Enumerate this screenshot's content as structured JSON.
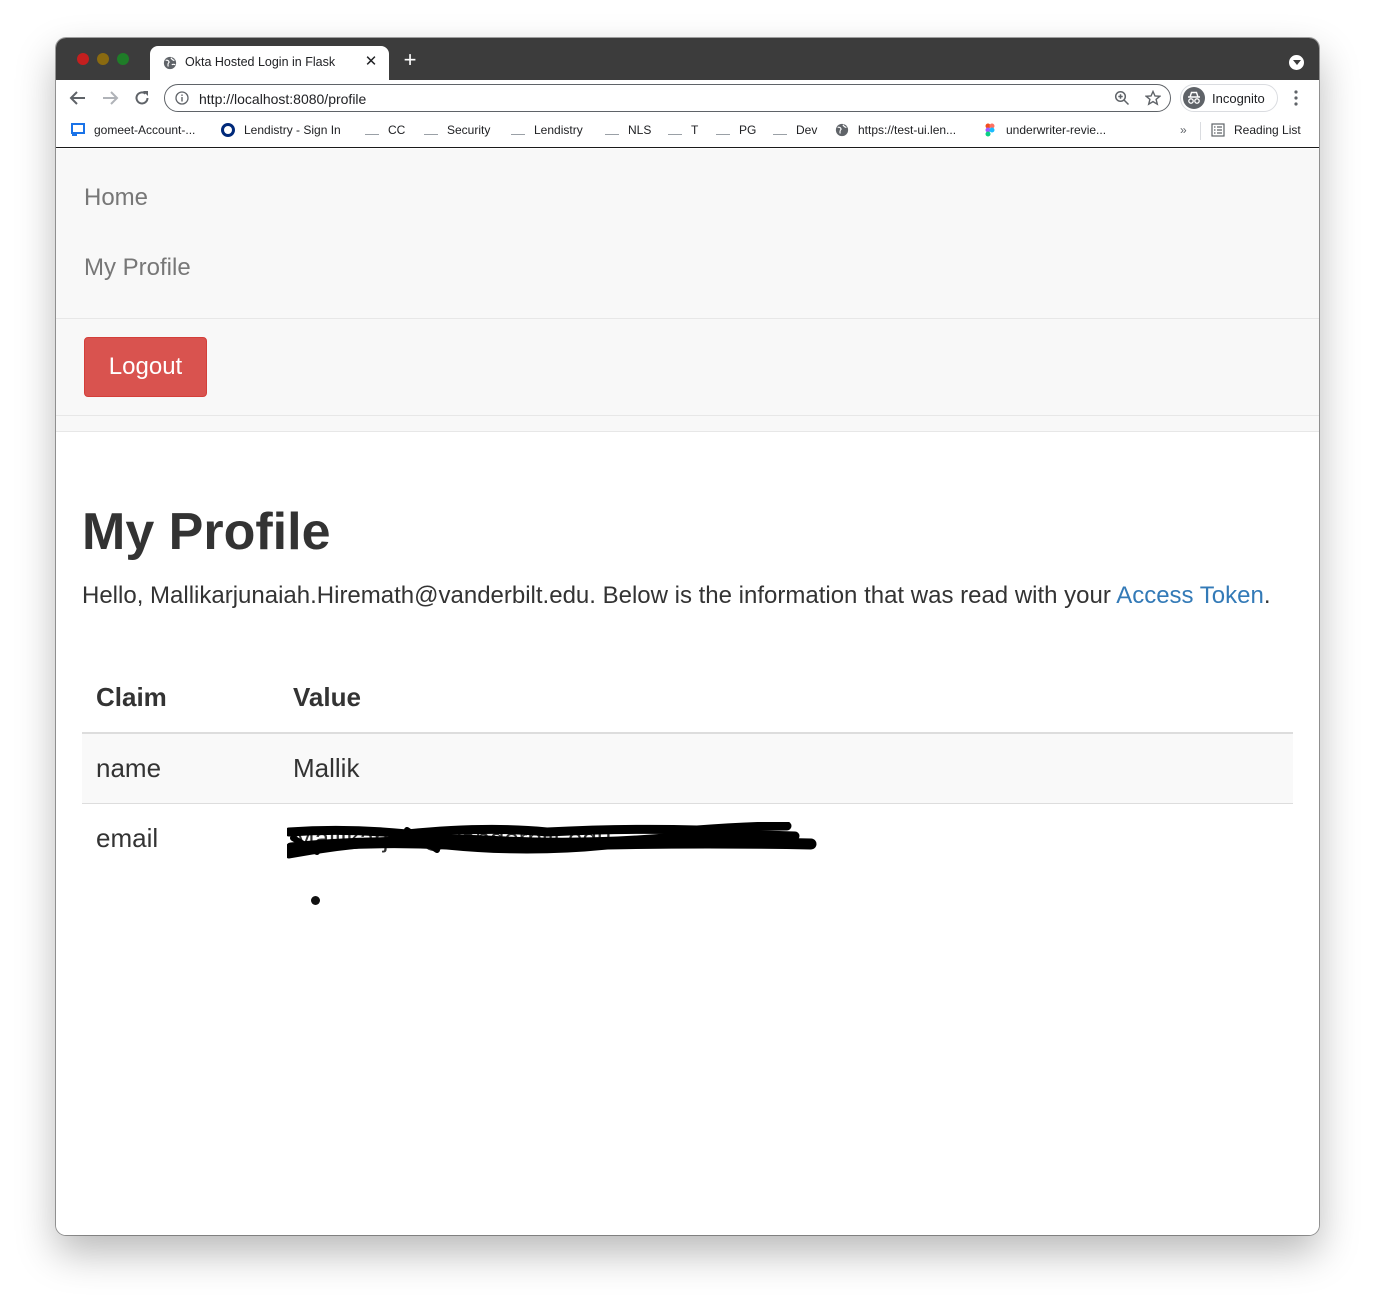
{
  "browser": {
    "tab": {
      "title": "Okta Hosted Login in Flask"
    },
    "address_bar": {
      "url": "http://localhost:8080/profile"
    },
    "profile": {
      "label": "Incognito"
    },
    "bookmarks": [
      {
        "label": "gomeet-Account-...",
        "icon": "gomeet-icon"
      },
      {
        "label": "Lendistry - Sign In",
        "icon": "okta-icon"
      },
      {
        "label": "CC",
        "icon": "folder-icon"
      },
      {
        "label": "Security",
        "icon": "folder-icon"
      },
      {
        "label": "Lendistry",
        "icon": "folder-icon"
      },
      {
        "label": "NLS",
        "icon": "folder-icon"
      },
      {
        "label": "T",
        "icon": "folder-icon"
      },
      {
        "label": "PG",
        "icon": "folder-icon"
      },
      {
        "label": "Dev",
        "icon": "folder-icon"
      },
      {
        "label": "https://test-ui.len...",
        "icon": "globe-icon"
      },
      {
        "label": "underwriter-revie...",
        "icon": "figma-icon"
      }
    ],
    "bookmarks_more": "»",
    "reading_list": "Reading List"
  },
  "navbar": {
    "links": [
      {
        "label": "Home"
      },
      {
        "label": "My Profile"
      }
    ],
    "logout_label": "Logout",
    "logout_color": "#d9534f"
  },
  "main": {
    "title": "My Profile",
    "intro_prefix": "Hello, Mallikarjunaiah.Hiremath@vanderbilt.edu. Below is the information that was read with your ",
    "intro_link": "Access Token",
    "intro_suffix": ".",
    "link_color": "#337ab7",
    "table": {
      "headers": [
        "Claim",
        "Value"
      ],
      "rows": [
        {
          "claim": "name",
          "value": "Mallik"
        },
        {
          "claim": "email",
          "value": "Mallikarj… @vanderbilt.edu"
        }
      ]
    }
  }
}
